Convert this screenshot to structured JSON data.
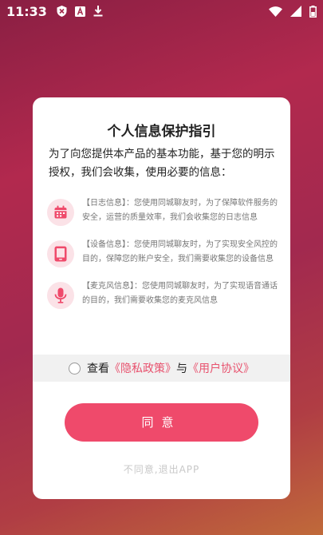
{
  "status_bar": {
    "time": "11:33",
    "left_icons": [
      "shield-x-icon",
      "a-box-icon",
      "download-icon"
    ],
    "right_icons": [
      "wifi-icon",
      "signal-icon",
      "battery-icon"
    ]
  },
  "dialog": {
    "title": "个人信息保护指引",
    "intro": "为了向您提供本产品的基本功能，基于您的明示授权，我们会收集，使用必要的信息：",
    "items": [
      {
        "icon": "calendar-icon",
        "text": "【日志信息】：您使用同城聊友时，为了保障软件服务的安全，运营的质量效率，我们会收集您的日志信息"
      },
      {
        "icon": "tablet-icon",
        "text": "【设备信息】：您使用同城聊友时，为了实现安全风控的目的，保障您的账户安全，我们需要收集您的设备信息"
      },
      {
        "icon": "microphone-icon",
        "text": "【麦克风信息】：您使用同城聊友时，为了实现语音通话的目的，我们需要收集您的麦克风信息"
      }
    ],
    "agree_bar": {
      "prefix": "查看",
      "privacy_link": "《隐私政策》",
      "conjunction": "与",
      "user_link": "《用户协议》"
    },
    "agree_button": "同意",
    "disagree_link": "不同意,退出APP"
  },
  "colors": {
    "accent": "#ef4a6b",
    "link": "#e8526e",
    "icon_bg": "#fbe2e7"
  }
}
